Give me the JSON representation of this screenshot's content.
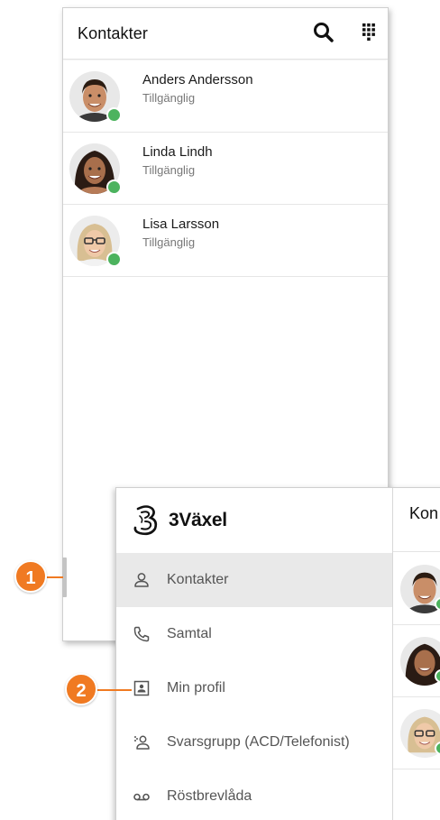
{
  "contacts_screen": {
    "title": "Kontakter",
    "icons": {
      "search": "search-icon",
      "dialpad": "dialpad-icon"
    },
    "contacts": [
      {
        "name": "Anders Andersson",
        "status": "Tillgänglig",
        "presence": "available"
      },
      {
        "name": "Linda Lindh",
        "status": "Tillgänglig",
        "presence": "available"
      },
      {
        "name": "Lisa Larsson",
        "status": "Tillgänglig",
        "presence": "available"
      }
    ]
  },
  "drawer": {
    "brand": "3Växel",
    "items": [
      {
        "label": "Kontakter",
        "icon": "person-icon",
        "active": true
      },
      {
        "label": "Samtal",
        "icon": "phone-icon",
        "active": false
      },
      {
        "label": "Min profil",
        "icon": "profile-card-icon",
        "active": false
      },
      {
        "label": "Svarsgrupp (ACD/Telefonist)",
        "icon": "group-icon",
        "active": false
      },
      {
        "label": "Röstbrevlåda",
        "icon": "voicemail-icon",
        "active": false
      }
    ],
    "peek_title": "Kon"
  },
  "callouts": [
    {
      "number": "1",
      "label_target": "drawer-handle"
    },
    {
      "number": "2",
      "label_target": "menu-item-min-profil"
    }
  ],
  "colors": {
    "presence_available": "#4cb35e",
    "callout": "#f07a22",
    "active_item_bg": "#e9e9e9"
  }
}
